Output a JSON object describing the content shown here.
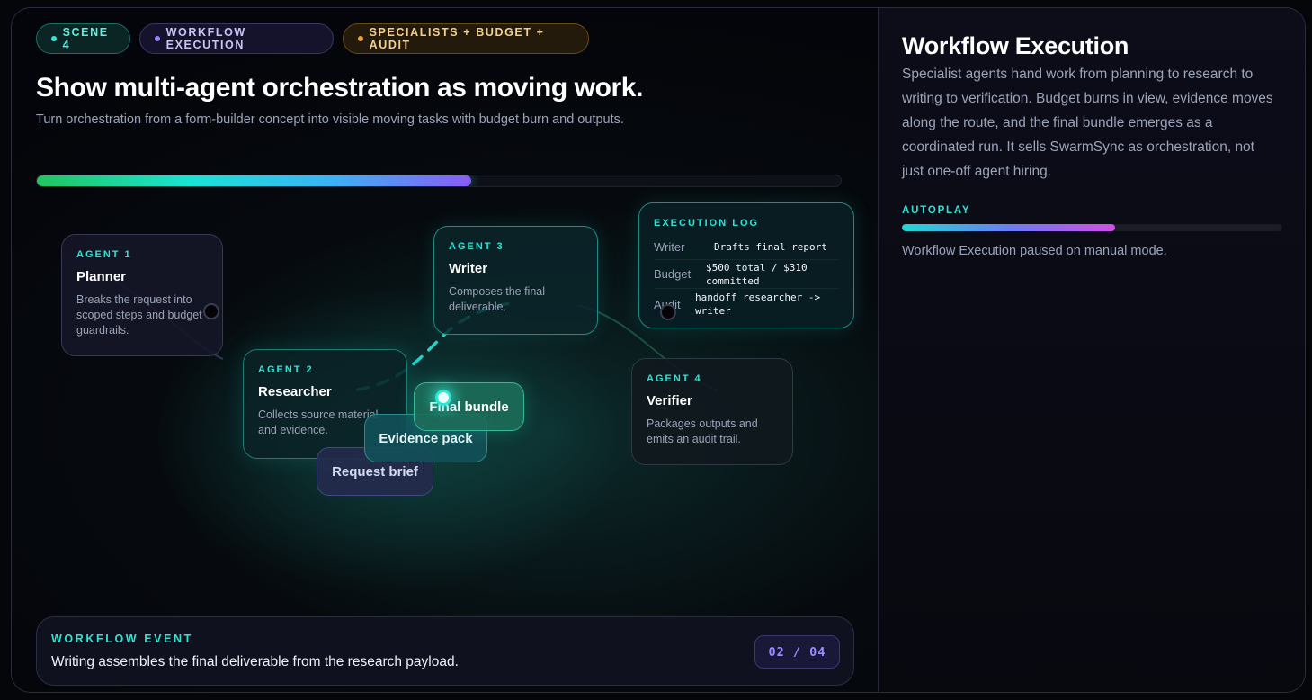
{
  "pills": {
    "scene": "SCENE 4",
    "workflow": "WORKFLOW EXECUTION",
    "specialists": "SPECIALISTS + BUDGET + AUDIT"
  },
  "hero": {
    "title": "Show multi-agent orchestration as moving work.",
    "subtitle": "Turn orchestration from a form-builder concept into visible moving tasks with budget burn and outputs."
  },
  "scene_progress": 0.54,
  "agents": [
    {
      "kicker": "AGENT 1",
      "name": "Planner",
      "desc": "Breaks the request into scoped steps and budget guardrails."
    },
    {
      "kicker": "AGENT 2",
      "name": "Researcher",
      "desc": "Collects source material and evidence."
    },
    {
      "kicker": "AGENT 3",
      "name": "Writer",
      "desc": "Composes the final deliverable."
    },
    {
      "kicker": "AGENT 4",
      "name": "Verifier",
      "desc": "Packages outputs and emits an audit trail."
    }
  ],
  "execution_log": {
    "title": "EXECUTION LOG",
    "rows": [
      {
        "key": "Writer",
        "value": "Drafts final report"
      },
      {
        "key": "Budget",
        "value": "$500 total / $310 committed"
      },
      {
        "key": "Audit",
        "value": "handoff researcher -> writer"
      }
    ]
  },
  "tokens": {
    "request": "Request brief",
    "evidence": "Evidence pack",
    "final": "Final bundle"
  },
  "event": {
    "kicker": "WORKFLOW EVENT",
    "message": "Writing assembles the final deliverable from the research payload.",
    "counter": "02 / 04"
  },
  "sidebar": {
    "title": "Workflow Execution",
    "body": "Specialist agents hand work from planning to research to writing to verification. Budget burns in view, evidence moves along the route, and the final bundle emerges as a coordinated run. It sells SwarmSync as orchestration, not just one-off agent hiring.",
    "autoplay_label": "AUTOPLAY",
    "autoplay_progress": 0.56,
    "autoplay_status": "Workflow Execution paused on manual mode."
  },
  "colors": {
    "accent_teal": "#2fe3d2",
    "accent_violet": "#8b5cf6",
    "accent_amber": "#f0a030",
    "background": "#05060a"
  }
}
